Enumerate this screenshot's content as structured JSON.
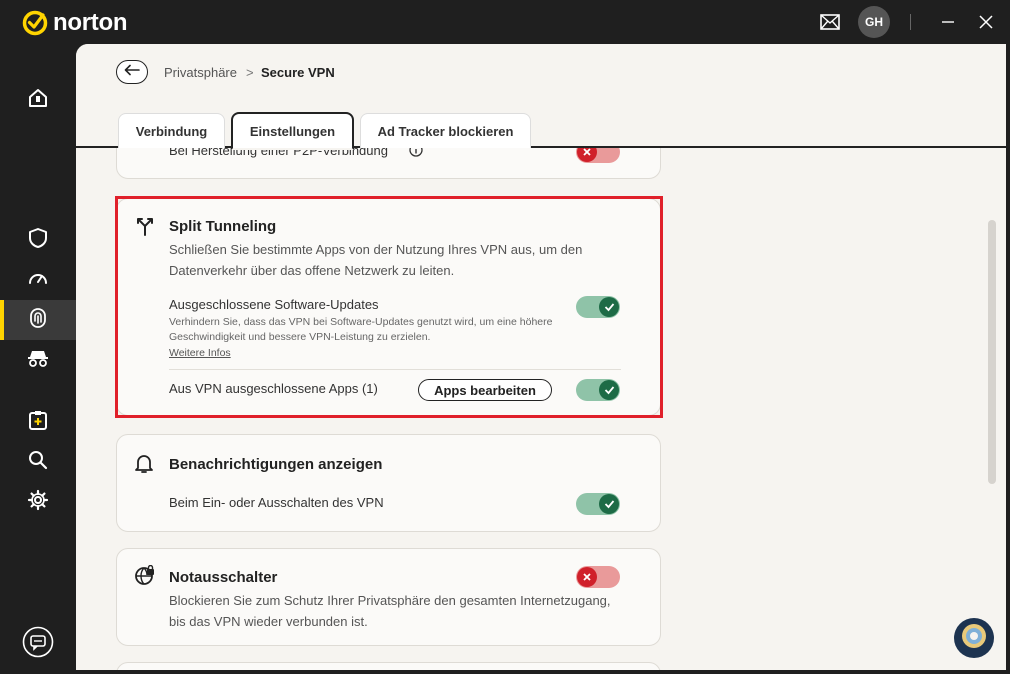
{
  "app": {
    "name": "norton",
    "user_initials": "GH"
  },
  "titlebar": {
    "mail_icon": "mail-icon",
    "minimize_icon": "minimize-icon",
    "close_icon": "close-icon"
  },
  "sidebar": {
    "items": [
      {
        "name": "home",
        "icon": "home-icon"
      },
      {
        "name": "device-security",
        "icon": "shield-icon"
      },
      {
        "name": "performance",
        "icon": "speedometer-icon"
      },
      {
        "name": "privacy",
        "icon": "fingerprint-icon",
        "active": true
      },
      {
        "name": "identity",
        "icon": "incognito-icon"
      },
      {
        "name": "add",
        "icon": "add-clipboard-icon"
      },
      {
        "name": "search",
        "icon": "search-icon"
      },
      {
        "name": "settings",
        "icon": "gear-icon"
      },
      {
        "name": "chat",
        "icon": "chat-icon"
      }
    ]
  },
  "breadcrumb": {
    "parent": "Privatsphäre",
    "separator": ">",
    "current": "Secure VPN"
  },
  "tabs": [
    {
      "label": "Verbindung"
    },
    {
      "label": "Einstellungen",
      "active": true
    },
    {
      "label": "Ad Tracker blockieren"
    }
  ],
  "cards": {
    "p2p": {
      "row_label": "Bei Herstellung einer P2P-Verbindung",
      "toggle": "off"
    },
    "split": {
      "title": "Split Tunneling",
      "description": "Schließen Sie bestimmte Apps von der Nutzung Ihres VPN aus, um den Datenverkehr über das offene Netzwerk zu leiten.",
      "updates_label": "Ausgeschlossene Software-Updates",
      "updates_sub": "Verhindern Sie, dass das VPN bei Software-Updates genutzt wird, um eine höhere Geschwindigkeit und bessere VPN-Leistung zu erzielen.",
      "updates_link": "Weitere Infos",
      "updates_toggle": "on",
      "apps_label": "Aus VPN ausgeschlossene Apps (1)",
      "apps_button": "Apps bearbeiten",
      "apps_toggle": "on"
    },
    "notifications": {
      "title": "Benachrichtigungen anzeigen",
      "row_label": "Beim Ein- oder Ausschalten des VPN",
      "toggle": "on"
    },
    "killswitch": {
      "title": "Notausschalter",
      "description": "Blockieren Sie zum Schutz Ihrer Privatsphäre den gesamten Internetzugang, bis das VPN wieder verbunden ist.",
      "toggle": "off"
    }
  },
  "colors": {
    "accent": "#ffd400",
    "toggle_on": "#1d6b46",
    "toggle_off": "#d0202a",
    "highlight": "#e0202a"
  }
}
